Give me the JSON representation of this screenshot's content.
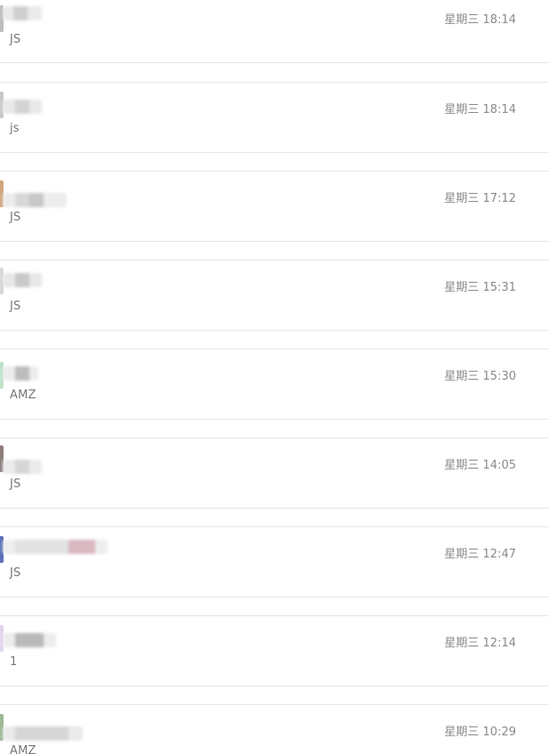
{
  "conversations": [
    {
      "preview": "JS",
      "time": "星期三 18:14",
      "edge_color": "#bdbdbd"
    },
    {
      "preview": "js",
      "time": "星期三 18:14",
      "edge_color": "#c9c9c9"
    },
    {
      "preview": "JS",
      "time": "星期三 17:12",
      "edge_color": "#d2a57d"
    },
    {
      "preview": "JS",
      "time": "星期三 15:31",
      "edge_color": "#d8d8d8"
    },
    {
      "preview": "AMZ",
      "time": "星期三 15:30",
      "edge_color": "#bfe3c8"
    },
    {
      "preview": "JS",
      "time": "星期三 14:05",
      "edge_color": "#8e7e7e"
    },
    {
      "preview": "JS",
      "time": "星期三 12:47",
      "edge_color": "#5a6fb8"
    },
    {
      "preview": "1",
      "time": "星期三 12:14",
      "edge_color": "#e0d6ec"
    },
    {
      "preview": "AMZ",
      "time": "星期三 10:29",
      "edge_color": "#9db892"
    }
  ]
}
